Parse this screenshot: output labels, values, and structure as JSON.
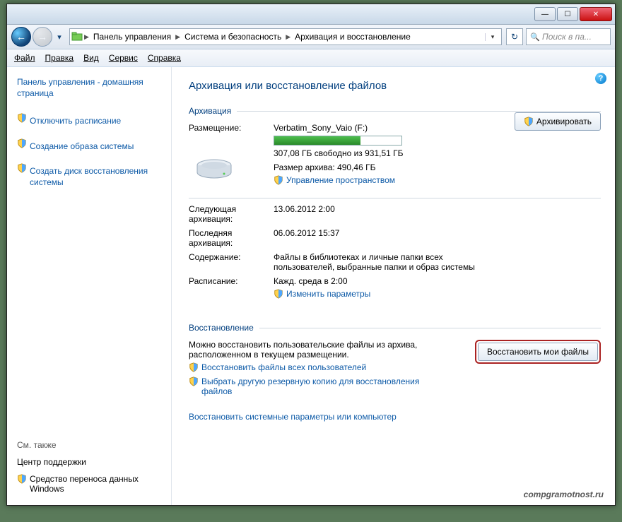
{
  "titlebar": {
    "min": "—",
    "max": "☐",
    "close": "✕"
  },
  "nav": {
    "breadcrumb": [
      "Панель управления",
      "Система и безопасность",
      "Архивация и восстановление"
    ],
    "search_placeholder": "Поиск в па..."
  },
  "menu": {
    "file": "Файл",
    "edit": "Правка",
    "view": "Вид",
    "service": "Сервис",
    "help": "Справка"
  },
  "sidebar": {
    "home": "Панель управления - домашняя страница",
    "items": [
      "Отключить расписание",
      "Создание образа системы",
      "Создать диск восстановления системы"
    ],
    "see_also": "См. также",
    "support": "Центр поддержки",
    "transfer": "Средство переноса данных Windows"
  },
  "page": {
    "title": "Архивация или восстановление файлов",
    "archive_section": "Архивация",
    "restore_section": "Восстановление",
    "location_lbl": "Размещение:",
    "location_val": "Verbatim_Sony_Vaio (F:)",
    "free_space": "307,08 ГБ свободно из 931,51 ГБ",
    "archive_size": "Размер архива: 490,46 ГБ",
    "manage_space": "Управление пространством",
    "next_lbl": "Следующая архивация:",
    "next_val": "13.06.2012 2:00",
    "last_lbl": "Последняя архивация:",
    "last_val": "06.06.2012 15:37",
    "content_lbl": "Содержание:",
    "content_val": "Файлы в библиотеках и личные папки всех пользователей, выбранные папки и образ системы",
    "schedule_lbl": "Расписание:",
    "schedule_val": "Кажд. среда в 2:00",
    "change_params": "Изменить параметры",
    "archive_btn": "Архивировать",
    "restore_text": "Можно восстановить пользовательские файлы из архива, расположенном в текущем размещении.",
    "restore_all": "Восстановить файлы всех пользователей",
    "restore_other": "Выбрать другую резервную копию для восстановления файлов",
    "restore_sys": "Восстановить системные параметры или компьютер",
    "restore_btn": "Восстановить мои файлы",
    "progress_pct": 68
  },
  "watermark": "compgramotnost.ru"
}
